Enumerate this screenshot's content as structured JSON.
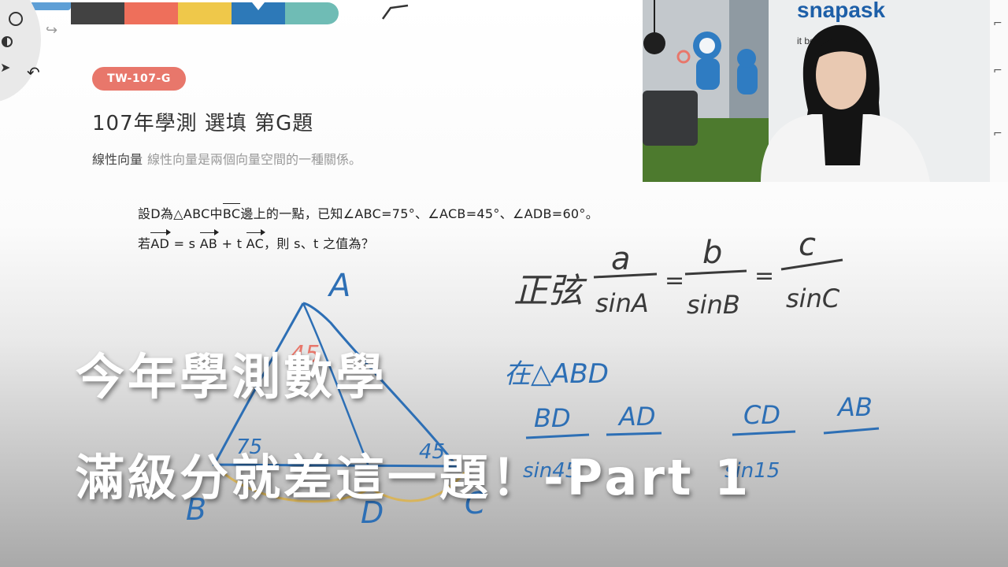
{
  "palette": {
    "colors": [
      "#424242",
      "#ee6f5b",
      "#efc84a",
      "#2d79b8",
      "#6fbcb5"
    ],
    "selected_index": 3
  },
  "tools": {
    "pen_icon": "circle-outline-icon",
    "color_icon": "contrast-icon",
    "redo_icon": "redo-arrow-icon",
    "undo_icon": "undo-arrow-icon"
  },
  "question": {
    "tag": "TW-107-G",
    "title": "107年學測 選填 第G題",
    "topic": "線性向量",
    "topic_desc": "線性向量是兩個向量空間的一種關係。",
    "line1": {
      "a": "設D為△ABC中",
      "bar": "BC",
      "b": "邊上的一點，已知∠ABC=75°、∠ACB=45°、∠ADB=60°。"
    },
    "line2": {
      "a": "若",
      "v1": "AD",
      "b": " = s ",
      "v2": "AB",
      "c": " + t ",
      "v3": "AC",
      "d": "，則 s、t 之值為？"
    }
  },
  "handwriting": {
    "law": "正弦",
    "num1": "a",
    "den1": "sinA",
    "num2": "b",
    "den2": "sinB",
    "num3": "c",
    "den3": "sinC",
    "in_triangle": "在△ABD",
    "f1_num": "BD",
    "f1_den": "sin45",
    "f2_num": "AD",
    "f3_num": "CD",
    "f3_den": "sin15",
    "f4_num": "AB",
    "vertex_a": "A",
    "vertex_b": "B",
    "vertex_c": "C",
    "vertex_d": "D",
    "angle_a": "45",
    "angle_b": "75",
    "angle_c": "45"
  },
  "webcam": {
    "brand": "snapask",
    "tagline": "it begins"
  },
  "headline": {
    "line1": "今年學測數學",
    "line2": "滿級分就差這一題！-Part 1"
  }
}
